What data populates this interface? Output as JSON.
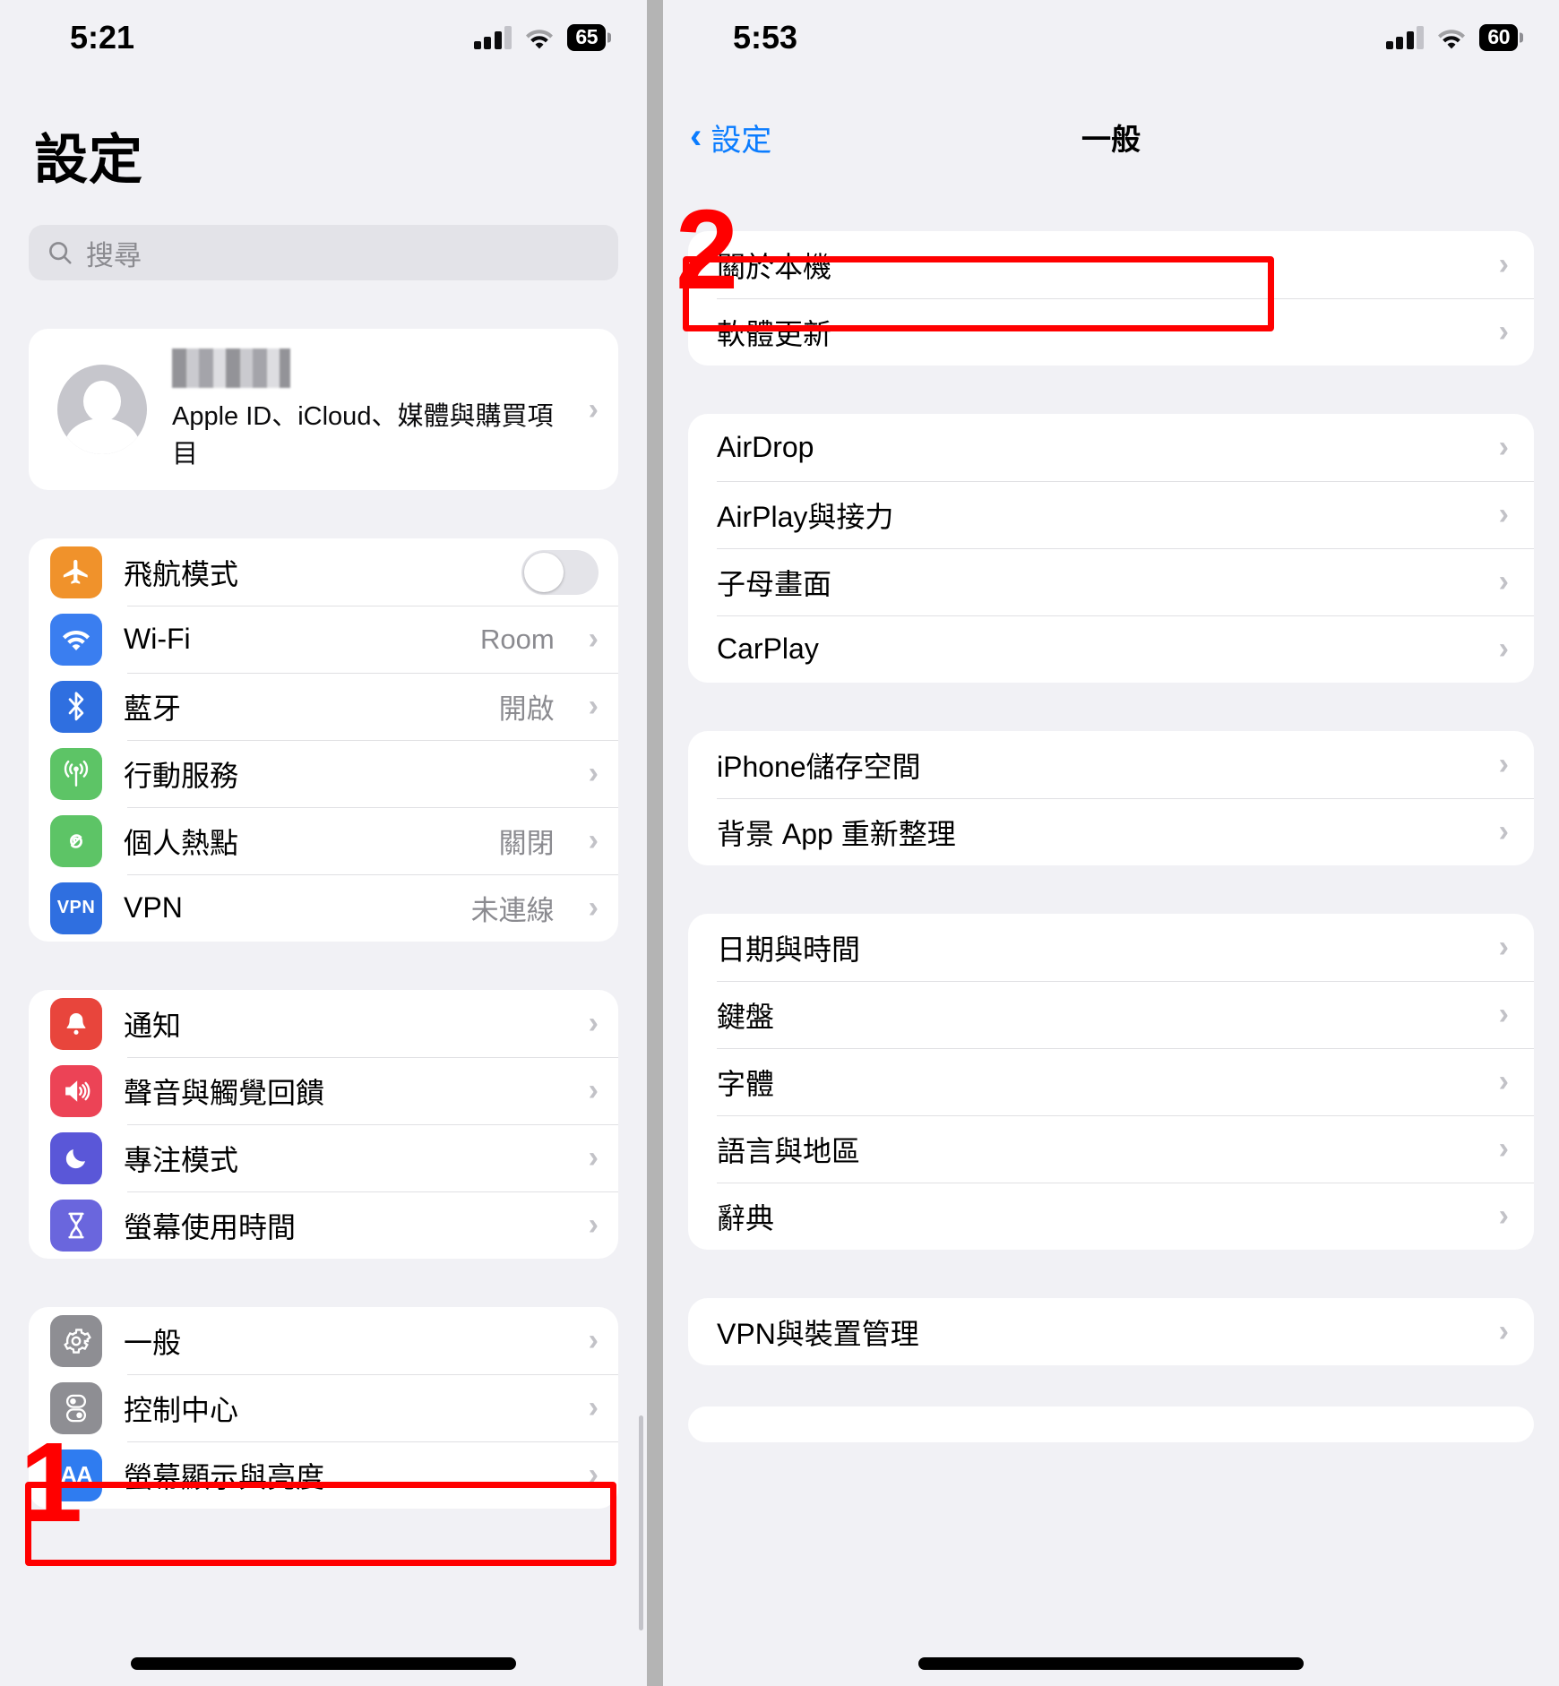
{
  "left": {
    "statusbar": {
      "time": "5:21",
      "battery": "65"
    },
    "title": "設定",
    "search": {
      "placeholder": "搜尋"
    },
    "account": {
      "subtitle": "Apple ID、iCloud、媒體與購買項目"
    },
    "group1": [
      {
        "label": "飛航模式",
        "value": "",
        "icon": "airplane-icon",
        "color": "#f0922b",
        "control": "toggle"
      },
      {
        "label": "Wi-Fi",
        "value": "Room",
        "icon": "wifi-icon",
        "color": "#3a7ef0",
        "control": "chevron"
      },
      {
        "label": "藍牙",
        "value": "開啟",
        "icon": "bluetooth-icon",
        "color": "#2f6fe0",
        "control": "chevron"
      },
      {
        "label": "行動服務",
        "value": "",
        "icon": "cellular-icon",
        "color": "#5dc466",
        "control": "chevron"
      },
      {
        "label": "個人熱點",
        "value": "關閉",
        "icon": "hotspot-icon",
        "color": "#5dc466",
        "control": "chevron"
      },
      {
        "label": "VPN",
        "value": "未連線",
        "icon": "vpn-icon",
        "color": "#2f6fe0",
        "control": "chevron"
      }
    ],
    "group2": [
      {
        "label": "通知",
        "value": "",
        "icon": "bell-icon",
        "color": "#e8453c",
        "control": "chevron"
      },
      {
        "label": "聲音與觸覺回饋",
        "value": "",
        "icon": "speaker-icon",
        "color": "#ec4356",
        "control": "chevron"
      },
      {
        "label": "專注模式",
        "value": "",
        "icon": "moon-icon",
        "color": "#5a57d8",
        "control": "chevron"
      },
      {
        "label": "螢幕使用時間",
        "value": "",
        "icon": "hourglass-icon",
        "color": "#6a66dd",
        "control": "chevron"
      }
    ],
    "group3": [
      {
        "label": "一般",
        "value": "",
        "icon": "gear-icon",
        "color": "#8e8e93",
        "control": "chevron"
      },
      {
        "label": "控制中心",
        "value": "",
        "icon": "sliders-icon",
        "color": "#8e8e93",
        "control": "chevron"
      },
      {
        "label": "螢幕顯示與亮度",
        "value": "",
        "icon": "aa-icon",
        "color": "#2f7cf0",
        "control": "chevron"
      }
    ]
  },
  "right": {
    "statusbar": {
      "time": "5:53",
      "battery": "60"
    },
    "nav": {
      "back_label": "設定",
      "title": "一般"
    },
    "group1": [
      {
        "label": "關於本機"
      },
      {
        "label": "軟體更新"
      }
    ],
    "group2": [
      {
        "label": "AirDrop"
      },
      {
        "label": "AirPlay與接力"
      },
      {
        "label": "子母畫面"
      },
      {
        "label": "CarPlay"
      }
    ],
    "group3": [
      {
        "label": "iPhone儲存空間"
      },
      {
        "label": "背景 App 重新整理"
      }
    ],
    "group4": [
      {
        "label": "日期與時間"
      },
      {
        "label": "鍵盤"
      },
      {
        "label": "字體"
      },
      {
        "label": "語言與地區"
      },
      {
        "label": "辭典"
      }
    ],
    "group5": [
      {
        "label": "VPN與裝置管理"
      }
    ]
  },
  "annotations": {
    "step1": "1",
    "step2": "2",
    "highlight_color": "#ff0000"
  }
}
